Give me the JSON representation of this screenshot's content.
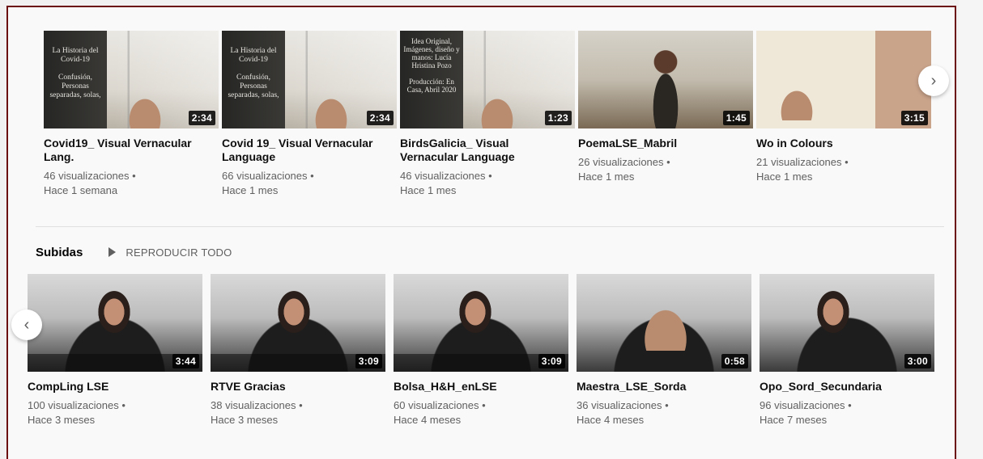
{
  "row1": {
    "videos": [
      {
        "title": "Covid19_ Visual Vernacular Lang.",
        "views": "46 visualizaciones",
        "age": "Hace 1 semana",
        "duration": "2:34",
        "overlay": "La Historia del Covid-19\n\nConfusión, Personas separadas, solas,"
      },
      {
        "title": "Covid 19_ Visual Vernacular Language",
        "views": "66 visualizaciones",
        "age": "Hace 1 mes",
        "duration": "2:34",
        "overlay": "La Historia del Covid-19\n\nConfusión, Personas separadas, solas,"
      },
      {
        "title": "BirdsGalicia_ Visual Vernacular Language",
        "views": "46 visualizaciones",
        "age": "Hace 1 mes",
        "duration": "1:23",
        "overlay": "Idea Original, Imágenes, diseño y manos: Lucía Hristina Pozo\n\nProducción: En Casa, Abril 2020"
      },
      {
        "title": "PoemaLSE_Mabril",
        "views": "26 visualizaciones",
        "age": "Hace 1 mes",
        "duration": "1:45"
      },
      {
        "title": "Wo in Colours",
        "views": "21 visualizaciones",
        "age": "Hace 1 mes",
        "duration": "3:15"
      }
    ],
    "next_arrow": "›"
  },
  "section": {
    "title": "Subidas",
    "play_all": "REPRODUCIR TODO"
  },
  "row2": {
    "videos": [
      {
        "title": "CompLing LSE",
        "views": "100 visualizaciones",
        "age": "Hace 3 meses",
        "duration": "3:44"
      },
      {
        "title": "RTVE Gracias",
        "views": "38 visualizaciones",
        "age": "Hace 3 meses",
        "duration": "3:09"
      },
      {
        "title": "Bolsa_H&H_enLSE",
        "views": "60 visualizaciones",
        "age": "Hace 4 meses",
        "duration": "3:09"
      },
      {
        "title": "Maestra_LSE_Sorda",
        "views": "36 visualizaciones",
        "age": "Hace 4 meses",
        "duration": "0:58"
      },
      {
        "title": "Opo_Sord_Secundaria",
        "views": "96 visualizaciones",
        "age": "Hace 7 meses",
        "duration": "3:00"
      }
    ],
    "prev_arrow": "‹"
  }
}
